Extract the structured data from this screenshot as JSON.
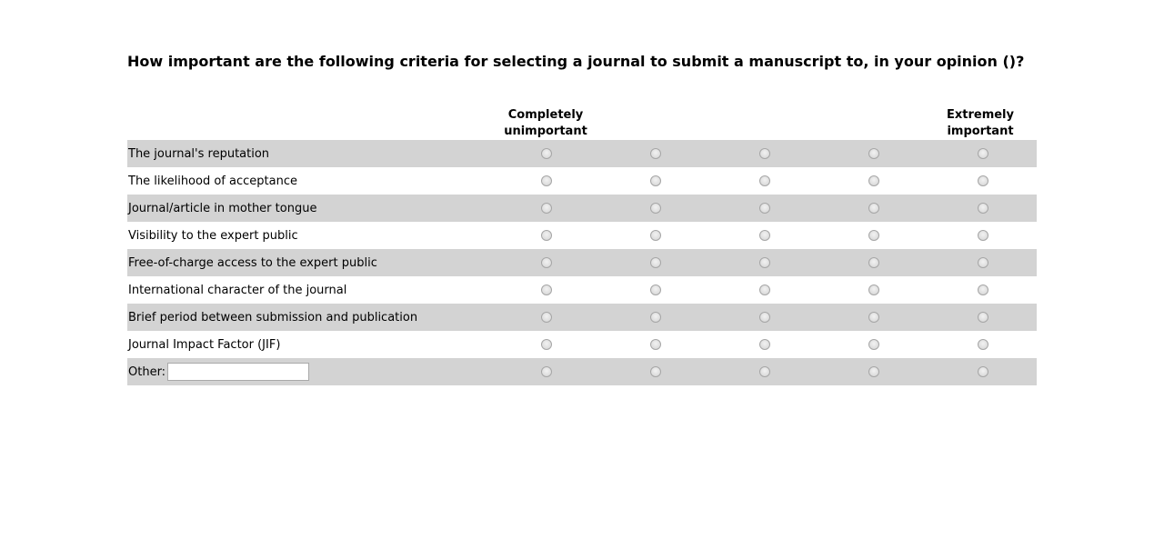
{
  "question": "How important are the following criteria for selecting a journal to submit a manuscript to, in your opinion ()?",
  "scale": {
    "low_label": "Completely unimportant",
    "high_label": "Extremely important",
    "points": 5
  },
  "rows": [
    {
      "label": "The journal's reputation"
    },
    {
      "label": "The likelihood of acceptance"
    },
    {
      "label": "Journal/article in mother tongue"
    },
    {
      "label": "Visibility to the expert public"
    },
    {
      "label": "Free-of-charge access to the expert public"
    },
    {
      "label": "International character of the journal"
    },
    {
      "label": "Brief period between submission and publication"
    },
    {
      "label": "Journal Impact Factor (JIF)"
    }
  ],
  "other": {
    "label": "Other:",
    "value": "",
    "placeholder": ""
  },
  "colors": {
    "shaded_row": "#d3d3d3",
    "background": "#ffffff"
  }
}
